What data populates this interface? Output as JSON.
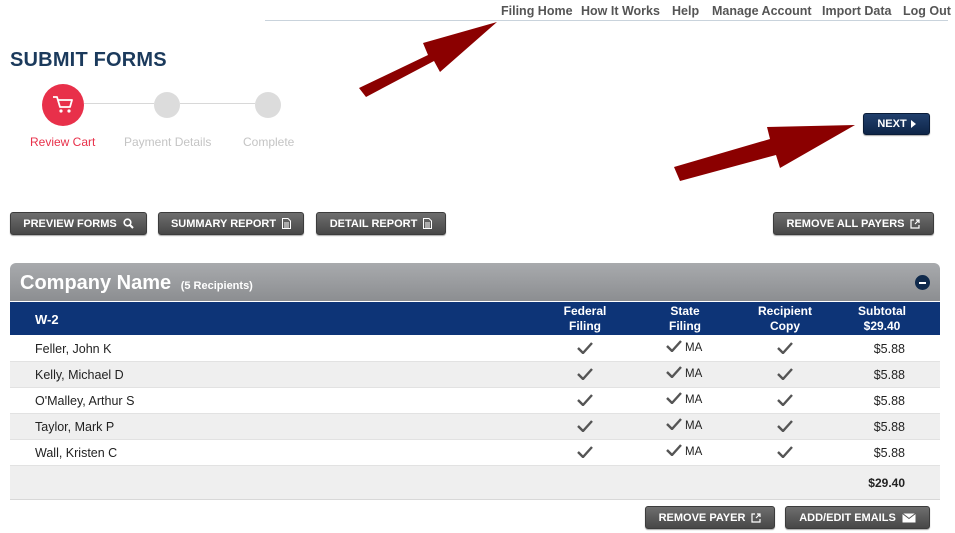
{
  "nav": {
    "items": [
      "Filing Home",
      "How It Works",
      "Help",
      "Manage Account",
      "Import Data",
      "Log Out"
    ]
  },
  "page": {
    "title": "SUBMIT FORMS"
  },
  "stepper": {
    "steps": [
      "Review Cart",
      "Payment Details",
      "Complete"
    ],
    "active_index": 0
  },
  "buttons": {
    "next": "NEXT",
    "preview_forms": "PREVIEW FORMS",
    "summary_report": "SUMMARY REPORT",
    "detail_report": "DETAIL REPORT",
    "remove_all_payers": "REMOVE ALL PAYERS",
    "remove_payer": "REMOVE PAYER",
    "add_edit_emails": "ADD/EDIT EMAILS"
  },
  "company": {
    "name": "Company Name",
    "recipients": "(5 Recipients)"
  },
  "table": {
    "form_type": "W-2",
    "columns": {
      "federal": [
        "Federal",
        "Filing"
      ],
      "state": [
        "State",
        "Filing"
      ],
      "recipient": [
        "Recipient",
        "Copy"
      ],
      "subtotal": [
        "Subtotal",
        "$29.40"
      ]
    },
    "rows": [
      {
        "name": "Feller, John K",
        "state": "MA",
        "subtotal": "$5.88"
      },
      {
        "name": "Kelly, Michael D",
        "state": "MA",
        "subtotal": "$5.88"
      },
      {
        "name": "O'Malley, Arthur S",
        "state": "MA",
        "subtotal": "$5.88"
      },
      {
        "name": "Taylor, Mark P",
        "state": "MA",
        "subtotal": "$5.88"
      },
      {
        "name": "Wall, Kristen C",
        "state": "MA",
        "subtotal": "$5.88"
      }
    ],
    "total": "$29.40"
  },
  "colors": {
    "accent_red": "#e8304a",
    "navy": "#0d3477",
    "annotation_arrow": "#8b0000"
  },
  "icons": {
    "cart": "cart-icon",
    "search": "search-icon",
    "document": "document-icon",
    "external": "external-link-icon",
    "envelope": "envelope-icon",
    "check": "check-icon",
    "collapse": "minus-circle-icon",
    "next": "caret-right-icon"
  }
}
